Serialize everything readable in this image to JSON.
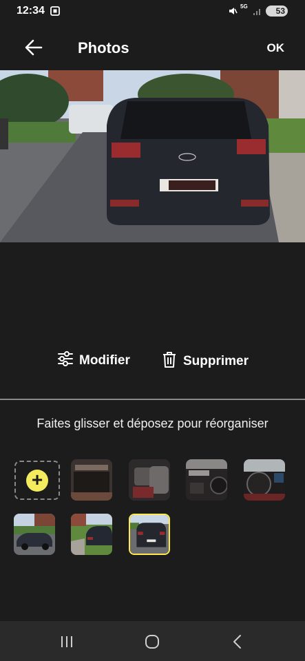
{
  "status_bar": {
    "time": "12:34",
    "network": "5G",
    "battery": "53",
    "icons": [
      "screenshot-icon",
      "mute-icon",
      "signal-icon",
      "battery-icon"
    ]
  },
  "header": {
    "title": "Photos",
    "ok_label": "OK",
    "back_icon": "arrow-left-icon"
  },
  "preview": {
    "description_icon": "photo-preview"
  },
  "actions": {
    "modify_label": "Modifier",
    "delete_label": "Supprimer",
    "modify_icon": "sliders-icon",
    "delete_icon": "trash-icon"
  },
  "reorder_hint": "Faites glisser et déposez pour réorganiser",
  "thumbnails": {
    "add_icon": "plus-icon",
    "count": 8,
    "selected_index": 7,
    "accent_color": "#f4ec5c"
  },
  "navbar": {
    "icons": [
      "recent-apps-icon",
      "home-icon",
      "back-icon"
    ]
  },
  "colors": {
    "background": "#1c1c1c",
    "accent": "#f4ec5c",
    "divider": "#8a8a8a"
  }
}
